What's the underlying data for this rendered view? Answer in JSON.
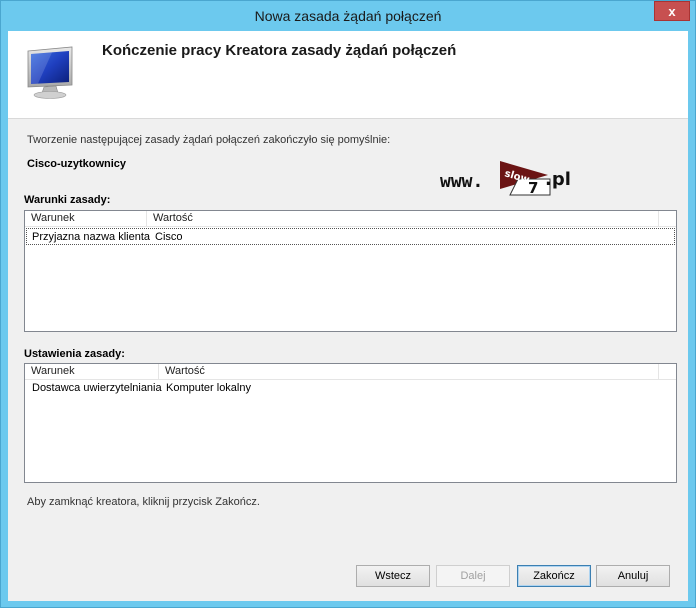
{
  "window": {
    "title": "Nowa zasada żądań połączeń",
    "close_glyph": "x"
  },
  "header": {
    "title": "Kończenie pracy Kreatora zasady żądań połączeń",
    "icon": "monitor-icon"
  },
  "intro": "Tworzenie następującej zasady żądań połączeń zakończyło się pomyślnie:",
  "policy_name": "Cisco-uzytkownicy",
  "watermark": {
    "prefix": "www.",
    "flag_top": "slow",
    "flag_bottom": "7",
    "suffix": ".pl"
  },
  "conditions": {
    "label": "Warunki zasady:",
    "columns": [
      "Warunek",
      "Wartość"
    ],
    "rows": [
      [
        "Przyjazna nazwa klienta",
        "Cisco"
      ]
    ]
  },
  "settings": {
    "label": "Ustawienia zasady:",
    "columns": [
      "Warunek",
      "Wartość"
    ],
    "rows": [
      [
        "Dostawca uwierzytelniania",
        "Komputer lokalny"
      ]
    ]
  },
  "finish_hint": "Aby zamknąć kreatora, kliknij przycisk Zakończ.",
  "buttons": {
    "back": "Wstecz",
    "next": "Dalej",
    "finish": "Zakończ",
    "cancel": "Anuluj"
  },
  "colors": {
    "titlebar": "#6cc9ee",
    "close": "#c75050",
    "dialog_bg": "#f0f0f0"
  }
}
